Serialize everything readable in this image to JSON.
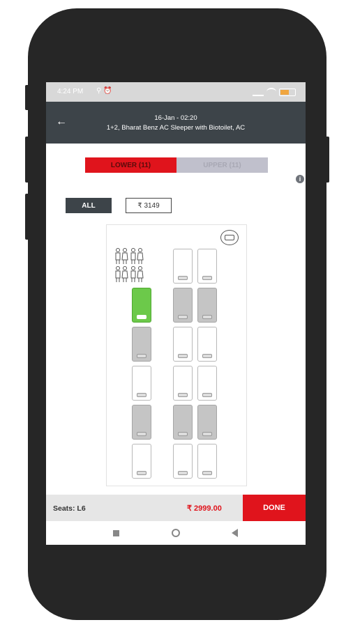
{
  "status": {
    "time": "4:24 PM",
    "left_icons": "⚲ ⏰"
  },
  "header": {
    "back_icon": "←",
    "line1": "16-Jan - 02:20",
    "line2": "1+2,  Bharat Benz AC Sleeper with Biotoilet, AC"
  },
  "deck_tabs": [
    {
      "label": "LOWER (11)",
      "active": true
    },
    {
      "label": "UPPER (11)",
      "active": false
    }
  ],
  "info_icon": "i",
  "filters": [
    {
      "label": "ALL",
      "active": true
    },
    {
      "label": "₹ 3149",
      "active": false
    }
  ],
  "seat_map": {
    "washroom_icon_text": "🚻🚻\n🚻🚻",
    "seats": [
      {
        "id": "r1c2",
        "status": "available"
      },
      {
        "id": "r1c3",
        "status": "available"
      },
      {
        "id": "r2c1",
        "status": "selected"
      },
      {
        "id": "r2c2",
        "status": "booked"
      },
      {
        "id": "r2c3",
        "status": "booked"
      },
      {
        "id": "r3c1",
        "status": "booked"
      },
      {
        "id": "r3c2",
        "status": "available"
      },
      {
        "id": "r3c3",
        "status": "available"
      },
      {
        "id": "r4c1",
        "status": "available"
      },
      {
        "id": "r4c2",
        "status": "available"
      },
      {
        "id": "r4c3",
        "status": "available"
      },
      {
        "id": "r5c1",
        "status": "booked"
      },
      {
        "id": "r5c2",
        "status": "booked"
      },
      {
        "id": "r5c3",
        "status": "booked"
      },
      {
        "id": "r6c1",
        "status": "available"
      },
      {
        "id": "r6c2",
        "status": "available"
      },
      {
        "id": "r6c3",
        "status": "available"
      }
    ]
  },
  "bottom_bar": {
    "seats_label": "Seats: L6",
    "price": "₹  2999.00",
    "done_label": "DONE"
  },
  "colors": {
    "accent": "#e0141c",
    "header_bg": "#3d4449",
    "selected_seat": "#6cc94a",
    "booked_seat": "#c5c5c5"
  }
}
